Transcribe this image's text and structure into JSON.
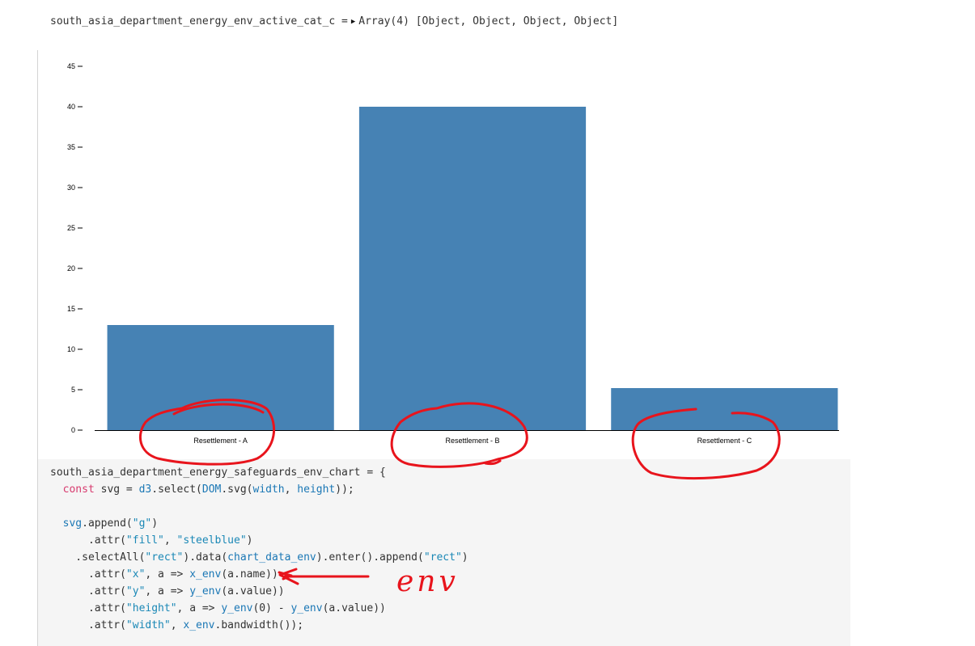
{
  "output": {
    "var_name": "south_asia_department_energy_env_active_cat_c",
    "equals": "=",
    "caret": "▶",
    "array_label": "Array(4)",
    "array_items": "[Object, Object, Object, Object]"
  },
  "chart_data": {
    "type": "bar",
    "categories": [
      "Resettlement - A",
      "Resettlement - B",
      "Resettlement - C"
    ],
    "values": [
      13,
      40,
      5.2
    ],
    "yticks": [
      0,
      5,
      10,
      15,
      20,
      25,
      30,
      35,
      40,
      45
    ],
    "ylim": [
      0,
      45
    ],
    "color": "#4682b4",
    "grid": false,
    "title": "",
    "xlabel": "",
    "ylabel": ""
  },
  "code": {
    "lines": [
      [
        {
          "t": "south_asia_department_energy_safeguards_env_chart = {",
          "c": "plain"
        }
      ],
      [
        {
          "t": "  ",
          "c": "plain"
        },
        {
          "t": "const",
          "c": "kw"
        },
        {
          "t": " svg = ",
          "c": "plain"
        },
        {
          "t": "d3",
          "c": "fn"
        },
        {
          "t": ".select(",
          "c": "plain"
        },
        {
          "t": "DOM",
          "c": "fn"
        },
        {
          "t": ".svg(",
          "c": "plain"
        },
        {
          "t": "width",
          "c": "fn"
        },
        {
          "t": ", ",
          "c": "plain"
        },
        {
          "t": "height",
          "c": "fn"
        },
        {
          "t": "));",
          "c": "plain"
        }
      ],
      [
        {
          "t": "",
          "c": "plain"
        }
      ],
      [
        {
          "t": "  ",
          "c": "plain"
        },
        {
          "t": "svg",
          "c": "fn"
        },
        {
          "t": ".append(",
          "c": "plain"
        },
        {
          "t": "\"g\"",
          "c": "str"
        },
        {
          "t": ")",
          "c": "plain"
        }
      ],
      [
        {
          "t": "      .attr(",
          "c": "plain"
        },
        {
          "t": "\"fill\"",
          "c": "str"
        },
        {
          "t": ", ",
          "c": "plain"
        },
        {
          "t": "\"steelblue\"",
          "c": "str"
        },
        {
          "t": ")",
          "c": "plain"
        }
      ],
      [
        {
          "t": "    .selectAll(",
          "c": "plain"
        },
        {
          "t": "\"rect\"",
          "c": "str"
        },
        {
          "t": ").data(",
          "c": "plain"
        },
        {
          "t": "chart_data_env",
          "c": "fn"
        },
        {
          "t": ").enter().append(",
          "c": "plain"
        },
        {
          "t": "\"rect\"",
          "c": "str"
        },
        {
          "t": ")",
          "c": "plain"
        }
      ],
      [
        {
          "t": "      .attr(",
          "c": "plain"
        },
        {
          "t": "\"x\"",
          "c": "str"
        },
        {
          "t": ", a => ",
          "c": "plain"
        },
        {
          "t": "x_env",
          "c": "fn"
        },
        {
          "t": "(a.name))",
          "c": "plain"
        }
      ],
      [
        {
          "t": "      .attr(",
          "c": "plain"
        },
        {
          "t": "\"y\"",
          "c": "str"
        },
        {
          "t": ", a => ",
          "c": "plain"
        },
        {
          "t": "y_env",
          "c": "fn"
        },
        {
          "t": "(a.value))",
          "c": "plain"
        }
      ],
      [
        {
          "t": "      .attr(",
          "c": "plain"
        },
        {
          "t": "\"height\"",
          "c": "str"
        },
        {
          "t": ", a => ",
          "c": "plain"
        },
        {
          "t": "y_env",
          "c": "fn"
        },
        {
          "t": "(0) - ",
          "c": "plain"
        },
        {
          "t": "y_env",
          "c": "fn"
        },
        {
          "t": "(a.value))",
          "c": "plain"
        }
      ],
      [
        {
          "t": "      .attr(",
          "c": "plain"
        },
        {
          "t": "\"width\"",
          "c": "str"
        },
        {
          "t": ", ",
          "c": "plain"
        },
        {
          "t": "x_env",
          "c": "fn"
        },
        {
          "t": ".bandwidth());",
          "c": "plain"
        }
      ]
    ]
  },
  "annotation": {
    "handwritten_text": "env",
    "ink_color": "#e8141c"
  }
}
